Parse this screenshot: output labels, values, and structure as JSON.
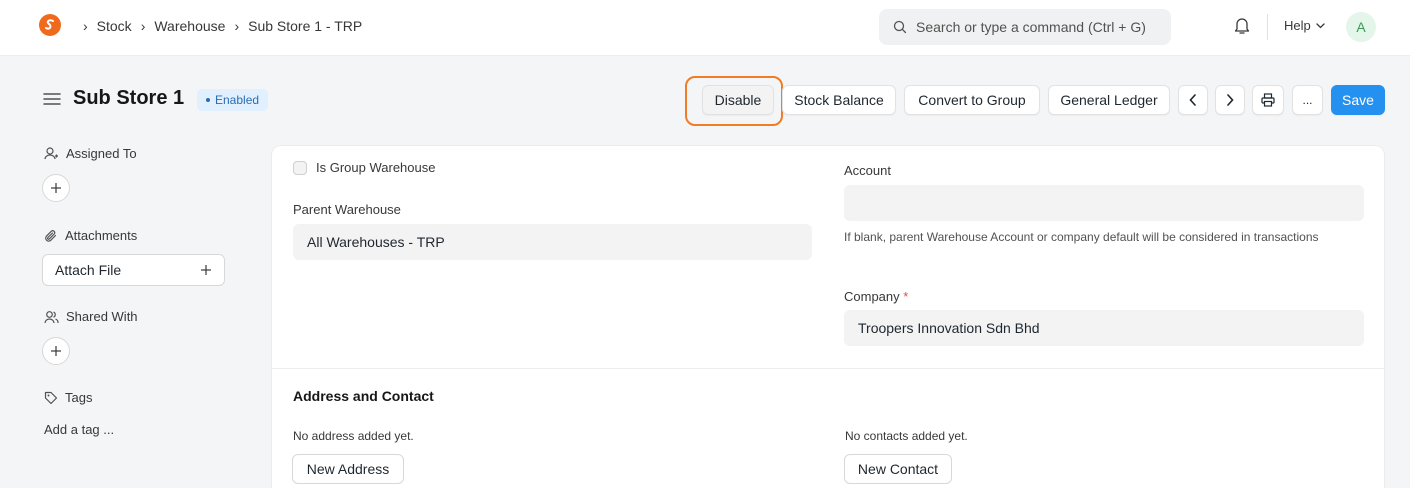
{
  "navbar": {
    "breadcrumbs": [
      "Stock",
      "Warehouse",
      "Sub Store 1 - TRP"
    ],
    "search_placeholder": "Search or type a command (Ctrl + G)",
    "help_label": "Help",
    "avatar_initial": "A"
  },
  "page": {
    "title": "Sub Store 1",
    "status_badge": "Enabled"
  },
  "toolbar": {
    "disable_label": "Disable",
    "stock_balance_label": "Stock Balance",
    "convert_to_group_label": "Convert to Group",
    "general_ledger_label": "General Ledger",
    "more_label": "...",
    "save_label": "Save"
  },
  "sidebar": {
    "assigned_to": "Assigned To",
    "attachments": "Attachments",
    "attach_file": "Attach File",
    "shared_with": "Shared With",
    "tags": "Tags",
    "add_tag": "Add a tag ..."
  },
  "form": {
    "is_group_warehouse": "Is Group Warehouse",
    "parent_warehouse_label": "Parent Warehouse",
    "parent_warehouse_value": "All Warehouses - TRP",
    "account_label": "Account",
    "account_value": "",
    "account_help": "If blank, parent Warehouse Account or company default will be considered in transactions",
    "company_label": "Company",
    "company_value": "Troopers Innovation Sdn Bhd"
  },
  "address_section": {
    "title": "Address and Contact",
    "no_address": "No address added yet.",
    "new_address": "New Address",
    "no_contacts": "No contacts added yet.",
    "new_contact": "New Contact"
  },
  "colors": {
    "primary": "#2490ef",
    "highlight": "#f07c25",
    "logo": "#f06a1d"
  }
}
